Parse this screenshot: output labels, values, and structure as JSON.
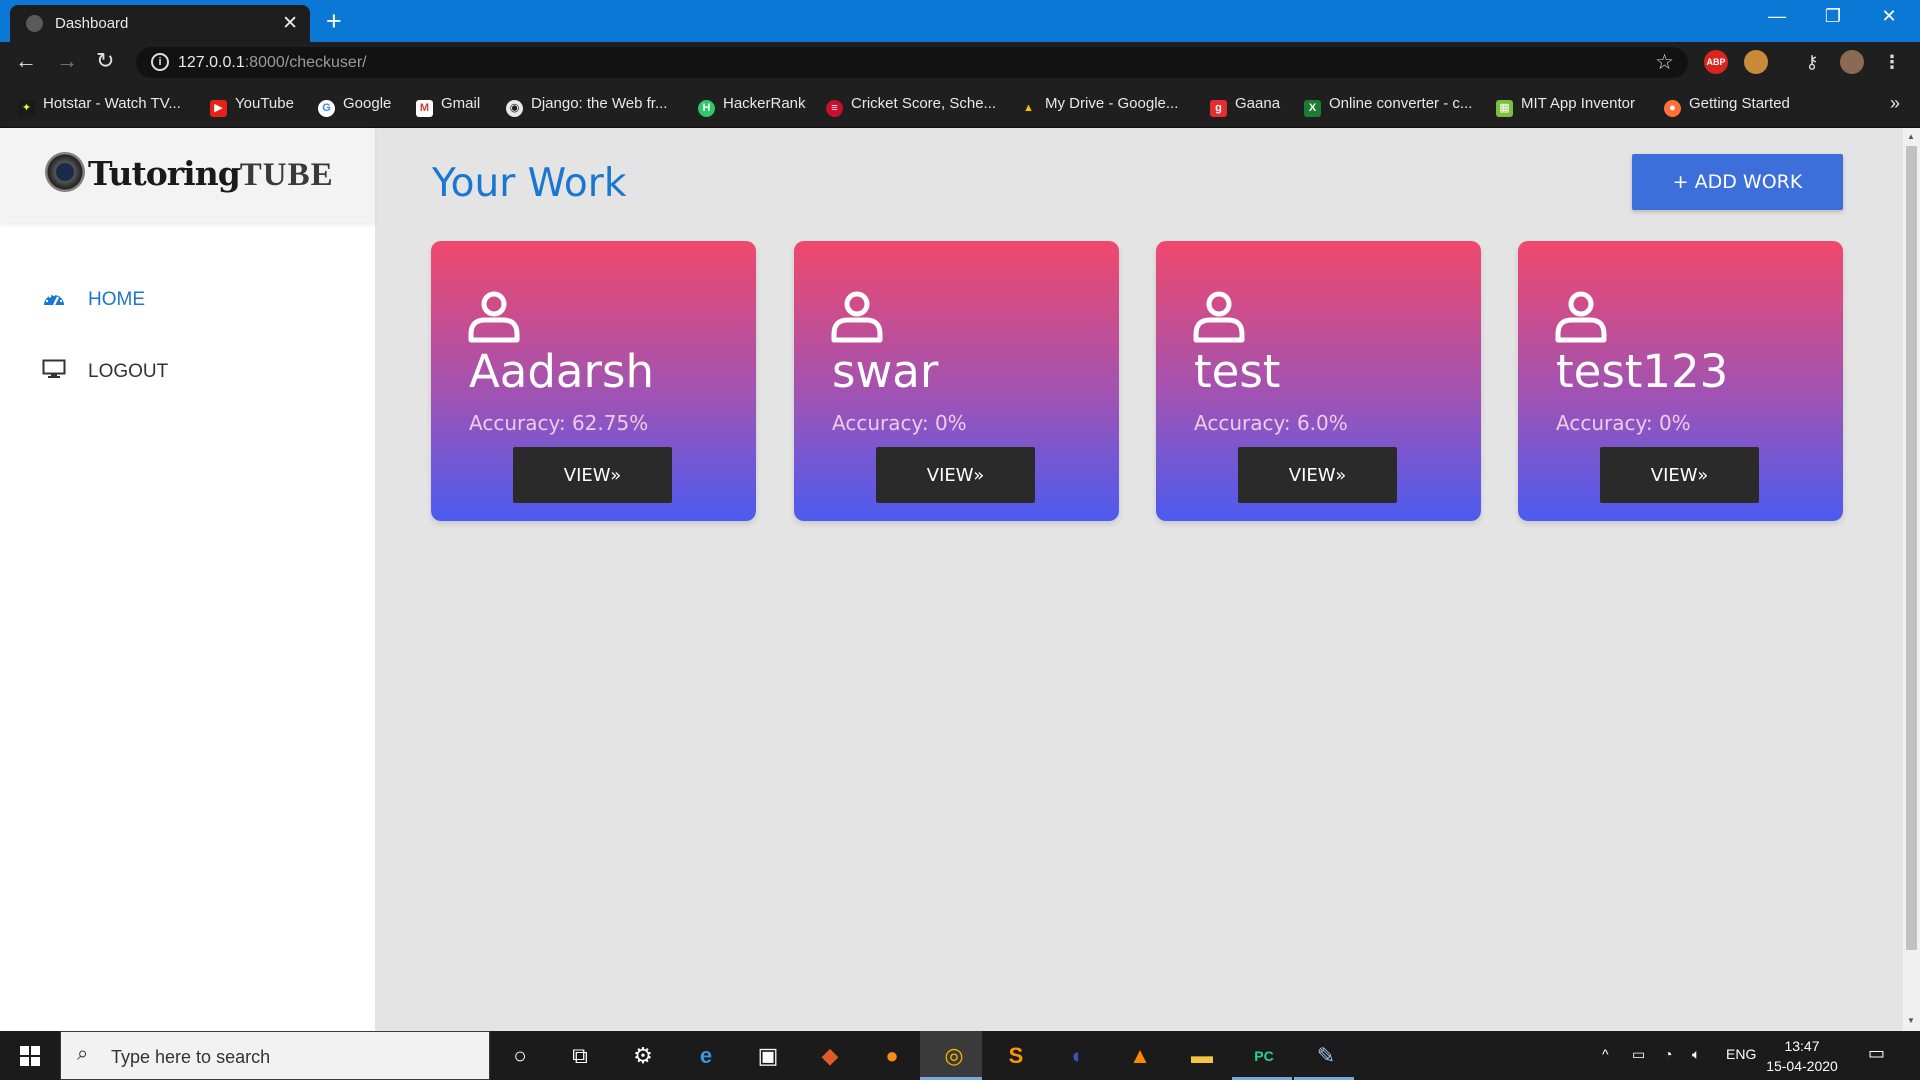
{
  "browser": {
    "tab_title": "Dashboard",
    "new_tab": "+",
    "url_host": "127.0.0.1",
    "url_path": ":8000/checkuser/",
    "window_controls": [
      "minimize-icon",
      "restore-icon",
      "close-icon"
    ],
    "extensions": [
      "ABP",
      "cookie-icon",
      "key-icon",
      "avatar"
    ]
  },
  "bookmarks": [
    {
      "label": "Hotstar - Watch TV...",
      "icon": "hotstar-icon",
      "color": "#1a1a1a"
    },
    {
      "label": "YouTube",
      "icon": "youtube-icon",
      "color": "#e62117"
    },
    {
      "label": "Google",
      "icon": "google-icon",
      "color": "#ffffff"
    },
    {
      "label": "Gmail",
      "icon": "gmail-icon",
      "color": "#d23f31"
    },
    {
      "label": "Django: the Web fr...",
      "icon": "globe-icon",
      "color": "#ffffff"
    },
    {
      "label": "HackerRank",
      "icon": "hackerrank-icon",
      "color": "#2ec866"
    },
    {
      "label": "Cricket Score, Sche...",
      "icon": "cricket-icon",
      "color": "#c8102e"
    },
    {
      "label": "My Drive - Google...",
      "icon": "drive-icon",
      "color": "#fbbc04"
    },
    {
      "label": "Gaana",
      "icon": "gaana-icon",
      "color": "#e72c30"
    },
    {
      "label": "Online converter - c...",
      "icon": "converter-icon",
      "color": "#1e7b34"
    },
    {
      "label": "MIT App Inventor",
      "icon": "appinventor-icon",
      "color": "#7bbf3a"
    },
    {
      "label": "Getting Started",
      "icon": "firefox-icon",
      "color": "#ff7139"
    }
  ],
  "sidebar": {
    "logo_main": "Tutoring",
    "logo_accent": "TUBE",
    "items": [
      {
        "label": "HOME",
        "icon": "dashboard-icon",
        "active": true
      },
      {
        "label": "LOGOUT",
        "icon": "monitor-icon",
        "active": false
      }
    ]
  },
  "main": {
    "title": "Your Work",
    "add_button": "+ ADD WORK",
    "cards": [
      {
        "name": "Aadarsh",
        "accuracy": "Accuracy: 62.75%",
        "button": "VIEW»"
      },
      {
        "name": "swar",
        "accuracy": "Accuracy: 0%",
        "button": "VIEW»"
      },
      {
        "name": "test",
        "accuracy": "Accuracy: 6.0%",
        "button": "VIEW»"
      },
      {
        "name": "test123",
        "accuracy": "Accuracy: 0%",
        "button": "VIEW»"
      }
    ]
  },
  "colors": {
    "accent": "#1976d2",
    "add_button": "#3d6fdb",
    "card_top": "#f0486c",
    "card_bottom": "#4c5bf0",
    "view_button": "#2a2a2a",
    "browser_frame": "#0a78d4"
  },
  "taskbar": {
    "search_placeholder": "Type here to search",
    "language": "ENG",
    "time": "13:47",
    "date": "15-04-2020"
  }
}
